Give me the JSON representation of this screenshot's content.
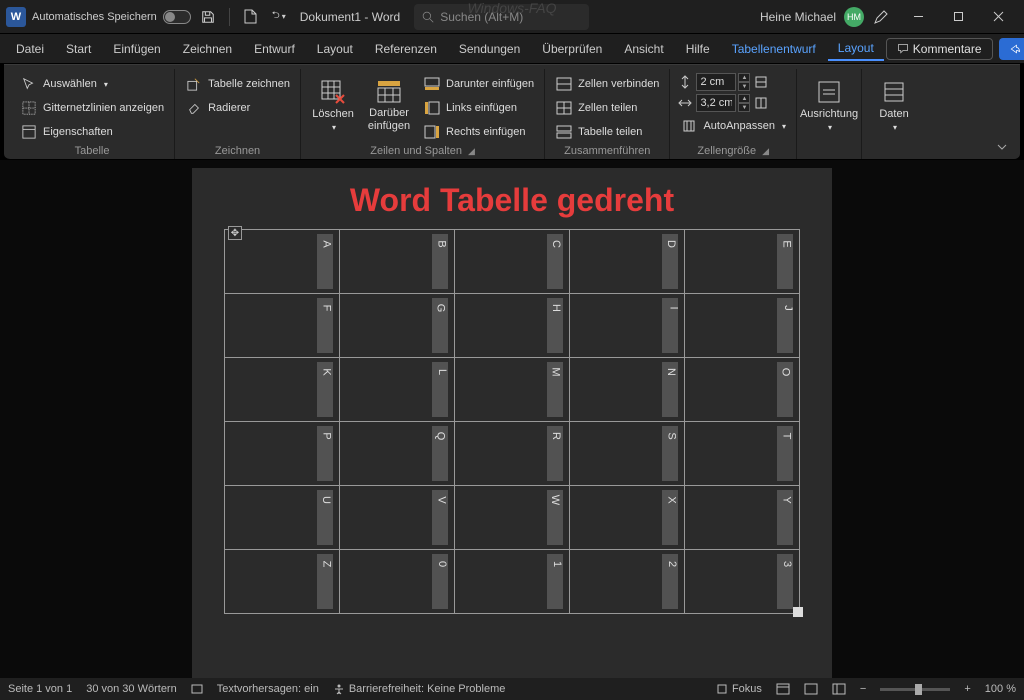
{
  "titlebar": {
    "autosave_label": "Automatisches Speichern",
    "doc_title": "Dokument1 - Word",
    "search_placeholder": "Suchen (Alt+M)",
    "watermark": "Windows-FAQ",
    "user_name": "Heine Michael",
    "user_initials": "HM"
  },
  "tabs": {
    "items": [
      "Datei",
      "Start",
      "Einfügen",
      "Zeichnen",
      "Entwurf",
      "Layout",
      "Referenzen",
      "Sendungen",
      "Überprüfen",
      "Ansicht",
      "Hilfe",
      "Tabellenentwurf",
      "Layout"
    ],
    "active_index": 12,
    "comments": "Kommentare",
    "share": "Teilen"
  },
  "ribbon": {
    "table": {
      "label": "Tabelle",
      "select": "Auswählen",
      "gridlines": "Gitternetzlinien anzeigen",
      "properties": "Eigenschaften"
    },
    "draw": {
      "label": "Zeichnen",
      "draw_table": "Tabelle zeichnen",
      "eraser": "Radierer"
    },
    "rowscols": {
      "label": "Zeilen und Spalten",
      "delete": "Löschen",
      "insert_above": "Darüber einfügen",
      "insert_below": "Darunter einfügen",
      "insert_left": "Links einfügen",
      "insert_right": "Rechts einfügen"
    },
    "merge": {
      "label": "Zusammenführen",
      "merge_cells": "Zellen verbinden",
      "split_cells": "Zellen teilen",
      "split_table": "Tabelle teilen"
    },
    "cellsize": {
      "label": "Zellengröße",
      "height_value": "2 cm",
      "width_value": "3,2 cm",
      "autofit": "AutoAnpassen"
    },
    "alignment": {
      "label": "Ausrichtung"
    },
    "data": {
      "label": "Daten"
    }
  },
  "document": {
    "heading": "Word Tabelle gedreht",
    "rows": [
      [
        "A",
        "B",
        "C",
        "D",
        "E"
      ],
      [
        "F",
        "G",
        "H",
        "I",
        "J"
      ],
      [
        "K",
        "L",
        "M",
        "N",
        "O"
      ],
      [
        "P",
        "Q",
        "R",
        "S",
        "T"
      ],
      [
        "U",
        "V",
        "W",
        "X",
        "Y"
      ],
      [
        "Z",
        "0",
        "1",
        "2",
        "3"
      ]
    ]
  },
  "statusbar": {
    "page": "Seite 1 von 1",
    "words": "30 von 30 Wörtern",
    "predictions": "Textvorhersagen: ein",
    "accessibility": "Barrierefreiheit: Keine Probleme",
    "focus": "Fokus",
    "zoom": "100 %"
  }
}
